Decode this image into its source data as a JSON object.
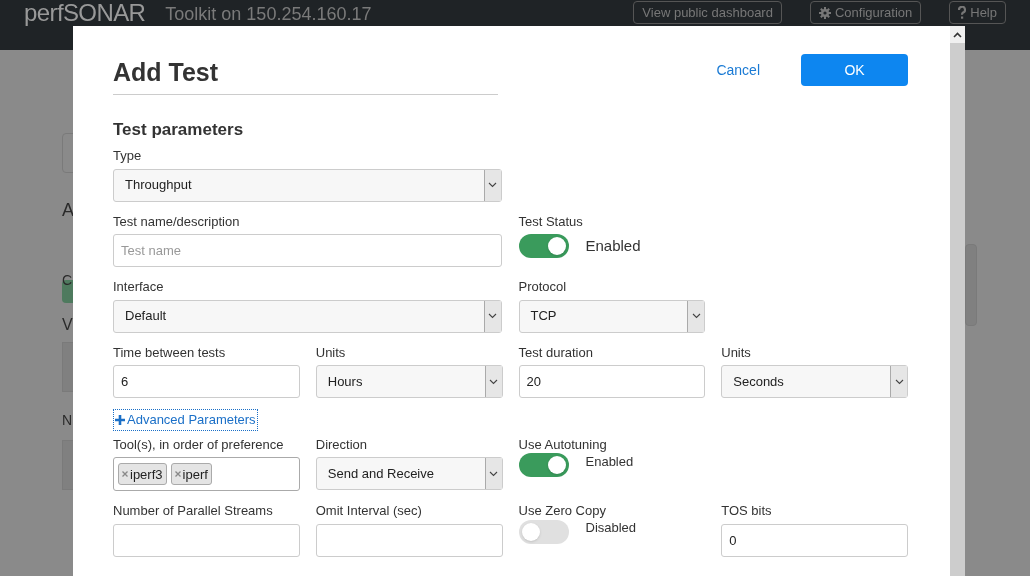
{
  "header": {
    "logo": "perfSONAR",
    "subtitle": "Toolkit on 150.254.160.17",
    "buttons": [
      {
        "label": "View public dashboard",
        "kind": "plain"
      },
      {
        "label": "Configuration",
        "kind": "gear"
      },
      {
        "label": "Help",
        "kind": "help"
      }
    ]
  },
  "background_fragments": [
    "A",
    "C",
    "V",
    "N"
  ],
  "dialog": {
    "title": "Add Test",
    "cancel": "Cancel",
    "ok": "OK",
    "section": "Test parameters",
    "rows": [
      {
        "fields": [
          {
            "kind": "select",
            "wide": true,
            "label": "Type",
            "value": "Throughput"
          }
        ]
      },
      {
        "fields": [
          {
            "kind": "input",
            "wide": true,
            "label": "Test name/description",
            "placeholder": "Test name"
          },
          {
            "kind": "toggle",
            "label": "Test Status",
            "on": true,
            "state_label": "Enabled"
          }
        ]
      },
      {
        "fields": [
          {
            "kind": "select",
            "wide": true,
            "label": "Interface",
            "value": "Default"
          },
          {
            "kind": "select",
            "label": "Protocol",
            "value": "TCP"
          }
        ]
      },
      {
        "fields": [
          {
            "kind": "input",
            "label": "Time between tests",
            "value": "6"
          },
          {
            "kind": "select",
            "label": "Units",
            "value": "Hours"
          },
          {
            "kind": "input",
            "label": "Test duration",
            "value": "20"
          },
          {
            "kind": "select",
            "label": "Units",
            "value": "Seconds"
          }
        ]
      },
      {
        "link": "Advanced Parameters"
      },
      {
        "fields": [
          {
            "kind": "tags",
            "label": "Tool(s), in order of preference",
            "tags": [
              "iperf3",
              "iperf"
            ]
          },
          {
            "kind": "select",
            "label": "Direction",
            "value": "Send and Receive"
          },
          {
            "kind": "toggle",
            "label": "Use Autotuning",
            "on": true,
            "state_label": "Enabled"
          }
        ]
      },
      {
        "fields": [
          {
            "kind": "input",
            "label": "Number of Parallel Streams"
          },
          {
            "kind": "input",
            "label": "Omit Interval (sec)"
          },
          {
            "kind": "toggle",
            "label": "Use Zero Copy",
            "on": false,
            "state_label": "Disabled"
          },
          {
            "kind": "input",
            "label": "TOS bits",
            "value": "0"
          }
        ]
      }
    ]
  }
}
